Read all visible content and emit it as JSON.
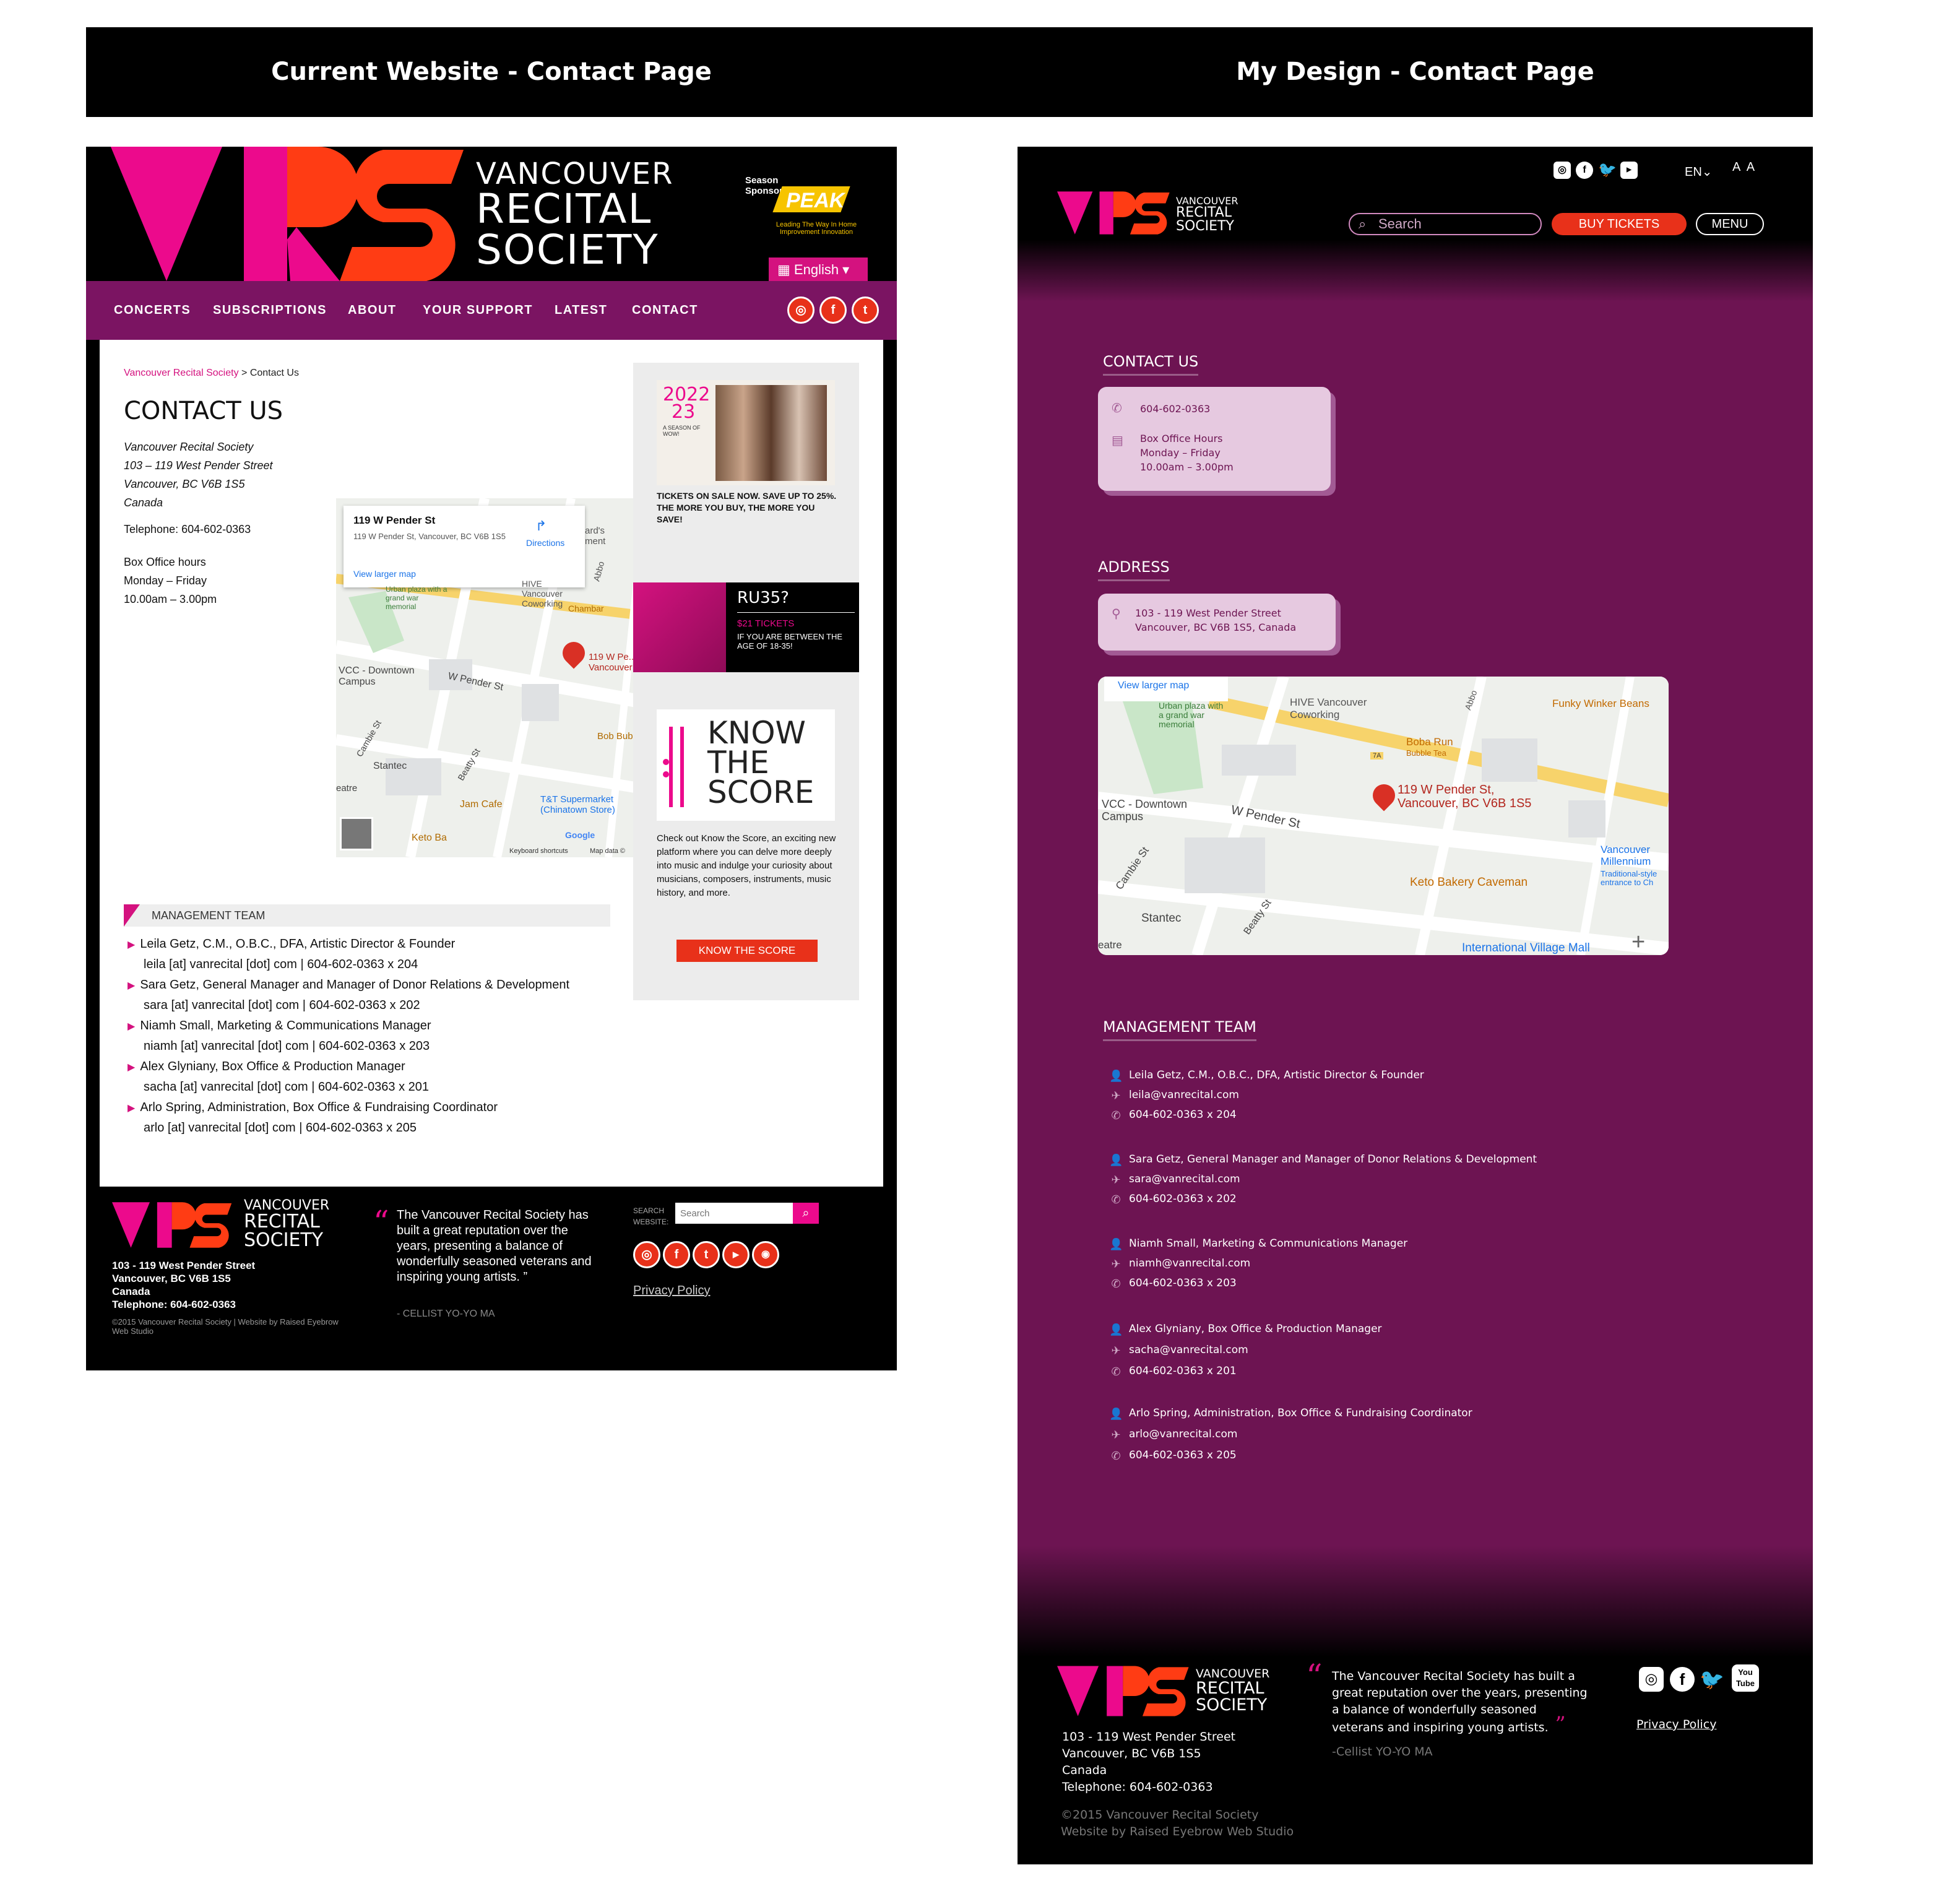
{
  "header": {
    "left_title": "Current Website - Contact Page",
    "right_title": "My Design - Contact Page"
  },
  "current": {
    "brand_lines": [
      "VANCOUVER",
      "RECITAL",
      "SOCIETY"
    ],
    "sponsor_label": "Season Sponsor",
    "sponsor_name": "PEAK",
    "sponsor_tagline": "Leading The Way In Home Improvement Innovation",
    "language": "English",
    "nav": [
      "CONCERTS",
      "SUBSCRIPTIONS",
      "ABOUT",
      "YOUR SUPPORT",
      "LATEST",
      "CONTACT"
    ],
    "breadcrumb_link": "Vancouver Recital Society",
    "breadcrumb_current": " > Contact Us",
    "title": "CONTACT US",
    "address": [
      "Vancouver Recital Society",
      "103 – 119 West Pender Street",
      "Vancouver, BC V6B 1S5",
      "Canada"
    ],
    "telephone": "Telephone: 604-602-0363",
    "hours": [
      "Box Office hours",
      "Monday – Friday",
      "10.00am – 3.00pm"
    ],
    "map": {
      "place_name": "119 W Pender St",
      "place_address": "119 W Pender St, Vancouver, BC V6B 1S5",
      "directions": "Directions",
      "larger_map": "View larger map",
      "labels": [
        "HIVE Vancouver Coworking",
        "Urban plaza with a grand war memorial",
        "119 W Pe... Vancouver",
        "VCC - Downtown Campus",
        "W Pender St",
        "Cambie St",
        "Stantec",
        "Beatty St",
        "Jam Cafe",
        "T&T Supermarket (Chinatown Store)",
        "Chambar",
        "Keto Ba",
        "Bob Bubb",
        "eatre",
        "ard's ment",
        "Abbo"
      ],
      "footer_shortcuts": "Keyboard shortcuts",
      "footer_data": "Map data ©",
      "google": "Google"
    },
    "management_head": "MANAGEMENT TEAM",
    "management": [
      {
        "name": "Leila Getz, C.M., O.B.C., DFA, Artistic Director & Founder",
        "contact": "leila [at] vanrecital [dot] com | 604-602-0363 x 204"
      },
      {
        "name": "Sara Getz, General Manager and Manager of Donor Relations & Development",
        "contact": "sara [at] vanrecital [dot] com | 604-602-0363 x 202"
      },
      {
        "name": "Niamh Small, Marketing & Communications Manager",
        "contact": "niamh [at] vanrecital [dot] com | 604-602-0363 x 203"
      },
      {
        "name": "Alex Glyniany, Box Office & Production Manager",
        "contact": "sacha [at] vanrecital [dot] com | 604-602-0363 x 201"
      },
      {
        "name": "Arlo Spring, Administration, Box Office & Fundraising Coordinator",
        "contact": "arlo [at] vanrecital [dot] com | 604-602-0363 x 205"
      }
    ],
    "promo1": {
      "year_top": "2022",
      "year_bottom": "23",
      "subtitle": "A SEASON OF WOW!",
      "text": "TICKETS ON SALE NOW. SAVE UP TO 25%. THE MORE YOU BUY, THE MORE YOU SAVE!"
    },
    "promo2": {
      "title": "RU35?",
      "price": "$21 TICKETS",
      "text": "IF YOU ARE BETWEEN THE AGE OF 18-35!"
    },
    "promo3": {
      "title_lines": [
        "KNOW",
        "THE",
        "SCORE"
      ],
      "text": "Check out Know the Score, an exciting new platform where you can delve more deeply into music and indulge your curiosity about musicians, composers, instruments, music history, and more.",
      "button": "KNOW THE SCORE"
    },
    "footer": {
      "address": [
        "103 - 119 West Pender Street",
        "Vancouver, BC V6B 1S5",
        "Canada",
        "Telephone: 604-602-0363"
      ],
      "copyright": "©2015 Vancouver Recital Society | Website by Raised Eyebrow Web Studio",
      "quote": "The Vancouver Recital Society has built a great reputation over the years, presenting a balance of wonderfully seasoned veterans and inspiring young artists. ”",
      "quote_author": "- CELLIST YO-YO MA",
      "search_label": "SEARCH WEBSITE:",
      "search_placeholder": "Search",
      "privacy": "Privacy Policy"
    }
  },
  "design": {
    "lang": "EN",
    "text_size": "A A",
    "search_placeholder": "Search",
    "buy_tickets": "BUY TICKETS",
    "menu": "MENU",
    "contact_head": "CONTACT US",
    "phone": "604-602-0363",
    "hours": [
      "Box Office Hours",
      "Monday – Friday",
      "10.00am – 3.00pm"
    ],
    "address_head": "ADDRESS",
    "address": [
      "103 - 119 West Pender Street",
      "Vancouver, BC V6B 1S5, Canada"
    ],
    "map": {
      "larger_map": "View larger map",
      "pin_label": [
        "119 W Pender St,",
        "Vancouver, BC V6B 1S5"
      ],
      "labels": [
        "HIVE Vancouver Coworking",
        "Urban plaza with a grand war memorial",
        "Funky Winker Beans",
        "Boba Run",
        "Bubble Tea",
        "VCC - Downtown Campus",
        "W Pender St",
        "Cambie St",
        "Stantec",
        "Beatty St",
        "Keto Bakery Caveman",
        "Vancouver Millennium",
        "Traditional-style entrance to Ch",
        "International Village Mall",
        "eatre",
        "Abbo",
        "7A"
      ]
    },
    "management_head": "MANAGEMENT TEAM",
    "management": [
      {
        "name": "Leila Getz, C.M., O.B.C., DFA, Artistic Director & Founder",
        "email": "leila@vanrecital.com",
        "phone": "604-602-0363 x 204"
      },
      {
        "name": "Sara Getz, General Manager and Manager of Donor Relations & Development",
        "email": "sara@vanrecital.com",
        "phone": "604-602-0363 x 202"
      },
      {
        "name": "Niamh Small, Marketing & Communications Manager",
        "email": "niamh@vanrecital.com",
        "phone": "604-602-0363 x 203"
      },
      {
        "name": "Alex Glyniany, Box Office & Production Manager",
        "email": "sacha@vanrecital.com",
        "phone": "604-602-0363 x 201"
      },
      {
        "name": "Arlo Spring, Administration, Box Office & Fundraising Coordinator",
        "email": "arlo@vanrecital.com",
        "phone": "604-602-0363 x 205"
      }
    ],
    "footer": {
      "address": [
        "103 - 119 West Pender Street",
        "Vancouver, BC V6B 1S5",
        "Canada",
        "Telephone: 604-602-0363"
      ],
      "copyright": [
        "©2015 Vancouver Recital Society",
        "Website by Raised Eyebrow Web Studio"
      ],
      "quote": "The Vancouver Recital Society has built a great reputation over the years, presenting a balance of wonderfully seasoned veterans and inspiring young artists.",
      "quote_author": "-Cellist YO-YO MA",
      "privacy": "Privacy Policy",
      "youtube_top": "You",
      "youtube_bottom": "Tube"
    }
  },
  "colors": {
    "brand_magenta": "#ec0a8c",
    "brand_orange": "#ff3c14",
    "nav_purple": "#7b1462",
    "design_purple": "#6d1452",
    "card_lilac": "#e6c9e0",
    "button_red": "#e8311a"
  },
  "icons": [
    "instagram-icon",
    "facebook-icon",
    "twitter-icon",
    "youtube-icon",
    "rss-icon",
    "search-icon",
    "phone-icon",
    "calendar-icon",
    "location-pin-icon",
    "person-icon",
    "send-icon",
    "chevron-down-icon",
    "flag-icon"
  ]
}
